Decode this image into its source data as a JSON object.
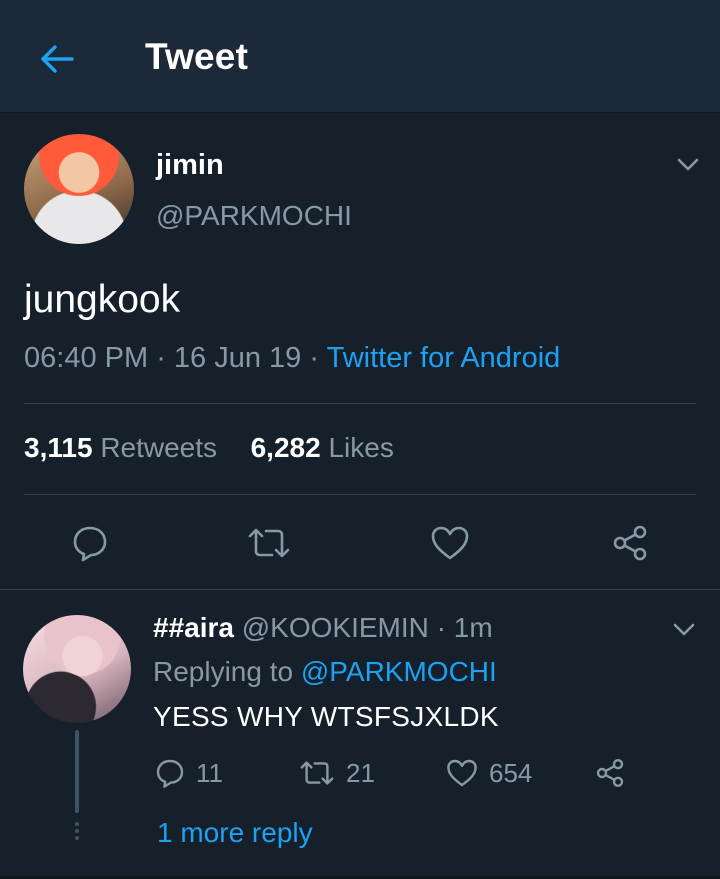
{
  "header": {
    "title": "Tweet",
    "back_icon": "arrow-left-icon",
    "accent": "#1da1f2"
  },
  "tweet": {
    "display_name": "jimin",
    "handle": "@PARKMOCHI",
    "text": "jungkook",
    "time": "06:40 PM",
    "date": "16 Jun 19",
    "source": "Twitter for Android",
    "retweets_count": "3,115",
    "retweets_label": "Retweets",
    "likes_count": "6,282",
    "likes_label": "Likes",
    "actions": [
      "reply-icon",
      "retweet-icon",
      "like-icon",
      "share-icon"
    ]
  },
  "reply": {
    "display_name": "##aira",
    "handle": "@KOOKIEMIN",
    "time": "1m",
    "replying_prefix": "Replying to",
    "replying_to": "@PARKMOCHI",
    "text": "YESS WHY WTSFSJXLDK",
    "reply_count": "11",
    "retweet_count": "21",
    "like_count": "654",
    "more_replies": "1 more reply"
  },
  "colors": {
    "background": "#15202b",
    "header_bg": "#1c2938",
    "secondary_text": "#8899a6",
    "link": "#1da1f2",
    "divider": "#38444d"
  }
}
